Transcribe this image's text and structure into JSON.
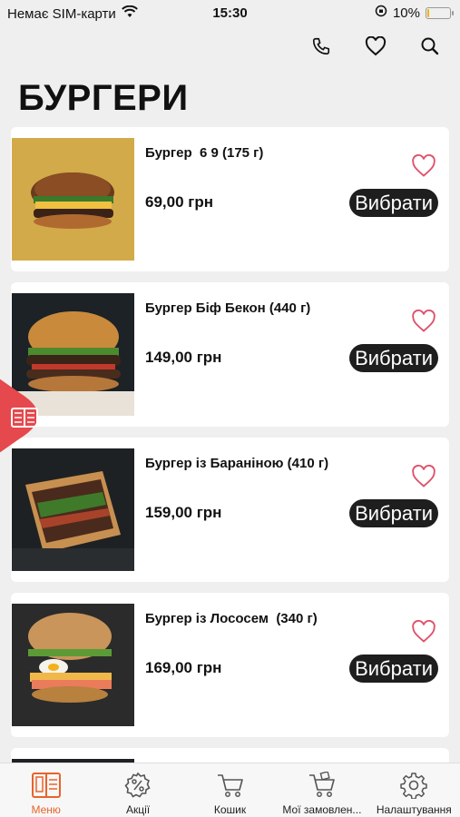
{
  "status": {
    "carrier": "Немає SIM-карти",
    "time": "15:30",
    "battery": "10%",
    "battery_level": 0.1
  },
  "header": {
    "title": "БУРГЕРИ",
    "actions": [
      "phone-icon",
      "heart-icon",
      "search-icon"
    ]
  },
  "products": [
    {
      "name": "Бургер  6 9 (175 г)",
      "price": "69,00 грн",
      "button": "Вибрати"
    },
    {
      "name": "Бургер Біф Бекон (440 г)",
      "price": "149,00 грн",
      "button": "Вибрати"
    },
    {
      "name": "Бургер із Бараніною (410 г)",
      "price": "159,00 грн",
      "button": "Вибрати"
    },
    {
      "name": "Бургер із Лососем  (340 г)",
      "price": "169,00 грн",
      "button": "Вибрати"
    }
  ],
  "colors": {
    "accent": "#e8632a",
    "heart": "#e0506a",
    "side_tab": "#e5484d",
    "button_bg": "#1e1e1e"
  },
  "tabs": [
    {
      "label": "Меню",
      "icon": "menu-book-icon",
      "active": true
    },
    {
      "label": "Акції",
      "icon": "discount-icon",
      "active": false
    },
    {
      "label": "Кошик",
      "icon": "cart-icon",
      "active": false
    },
    {
      "label": "Мої замовлен...",
      "icon": "orders-cart-icon",
      "active": false
    },
    {
      "label": "Налаштування",
      "icon": "gear-icon",
      "active": false
    }
  ]
}
